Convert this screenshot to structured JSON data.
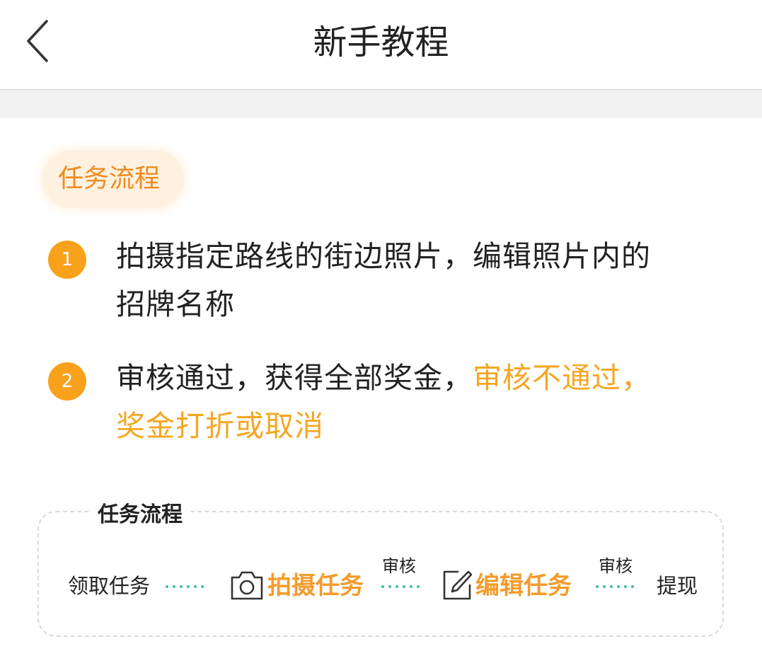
{
  "header": {
    "title": "新手教程",
    "back_icon": "chevron-left-icon"
  },
  "section": {
    "tag_label": "任务流程"
  },
  "steps": [
    {
      "number": "1",
      "line1": "拍摄指定路线的街边照片，编辑照片内的",
      "line2": "招牌名称"
    },
    {
      "number": "2",
      "line1_plain": "审核通过，获得全部奖金，",
      "line1_highlight": "审核不通过，",
      "line2_highlight": "奖金打折或取消"
    }
  ],
  "flow": {
    "title": "任务流程",
    "step_receive": "领取任务",
    "step_shoot": "拍摄任务",
    "review_label_1": "审核",
    "step_edit": "编辑任务",
    "review_label_2": "审核",
    "step_withdraw": "提现",
    "shoot_icon": "camera-icon",
    "edit_icon": "edit-pencil-icon"
  },
  "colors": {
    "accent_orange": "#f5a623",
    "badge_orange": "#f8a21c",
    "tag_text": "#ef8a1f",
    "tag_bg": "#fff1e0",
    "dots_teal": "#3cbfa0"
  }
}
